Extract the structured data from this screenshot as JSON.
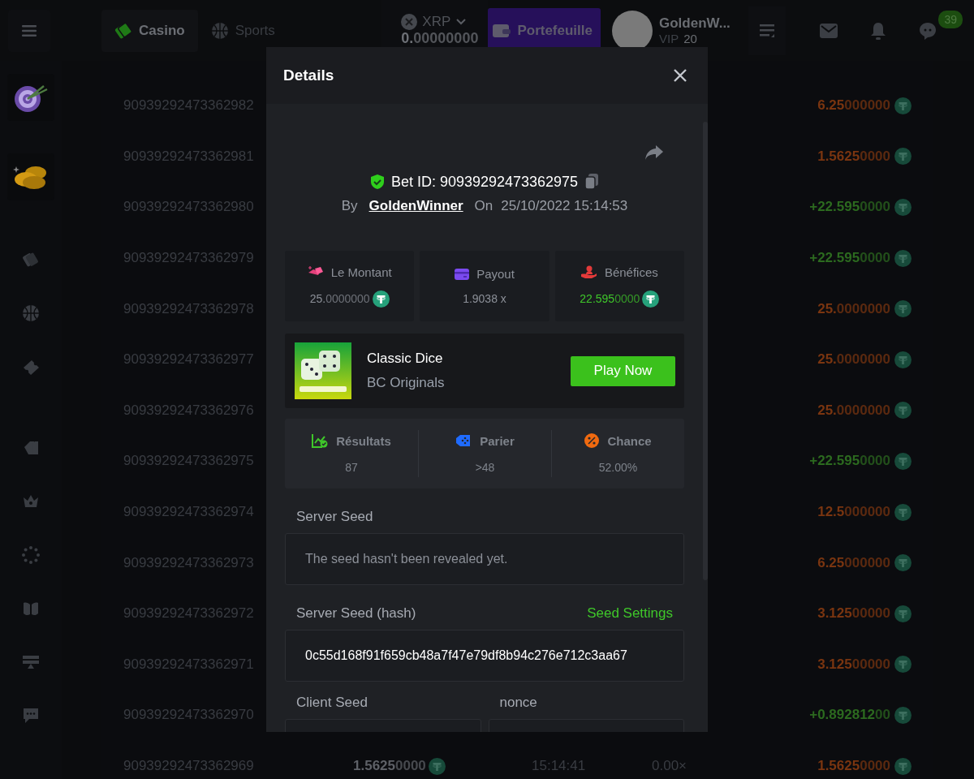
{
  "top_bar": {
    "nav_tabs": [
      {
        "label": "Casino",
        "selected": true,
        "kind": "casino"
      },
      {
        "label": "Sports",
        "selected": false,
        "kind": "sports"
      }
    ],
    "currency": {
      "code": "XRP",
      "balance": "0.00000000"
    },
    "wallet_button": "Portefeuille",
    "user": {
      "name": "GoldenW...",
      "vip_label": "VIP",
      "vip_level": "20"
    },
    "chat_badge": "39"
  },
  "bets": [
    {
      "id": "90939292473362982",
      "amount": "6.25000000",
      "color": "#7a3510"
    },
    {
      "id": "90939292473362981",
      "amount": "1.56250000",
      "color": "#7a3510"
    },
    {
      "id": "90939292473362980",
      "amount": "+22.5950000",
      "color": "#2c6a1f"
    },
    {
      "id": "90939292473362979",
      "amount": "+22.5950000",
      "color": "#2c6a1f"
    },
    {
      "id": "90939292473362978",
      "amount": "25.0000000",
      "color": "#7a3510"
    },
    {
      "id": "90939292473362977",
      "amount": "25.0000000",
      "color": "#7a3510"
    },
    {
      "id": "90939292473362976",
      "amount": "25.0000000",
      "color": "#7a3510"
    },
    {
      "id": "90939292473362975",
      "amount": "+22.5950000",
      "color": "#2c6a1f"
    },
    {
      "id": "90939292473362974",
      "amount": "12.5000000",
      "color": "#7a3510"
    },
    {
      "id": "90939292473362973",
      "amount": "6.25000000",
      "color": "#7a3510"
    },
    {
      "id": "90939292473362972",
      "amount": "3.12500000",
      "color": "#7a3510"
    },
    {
      "id": "90939292473362971",
      "amount": "3.12500000",
      "color": "#7a3510"
    },
    {
      "id": "90939292473362970",
      "amount": "+0.89281200",
      "color": "#2c6a1f"
    },
    {
      "id": "90939292473362969",
      "bet_amount": "1.56250000",
      "time": "15:14:41",
      "payout": "0.00×",
      "amount": "1.56250000",
      "color": "#7a3510"
    }
  ],
  "modal": {
    "title": "Details",
    "bet_id_label": "Bet ID:",
    "bet_id": "90939292473362975",
    "by_label": "By",
    "player": "GoldenWinner",
    "on_label": "On",
    "date": "25/10/2022 15:14:53",
    "stats": [
      {
        "kind": "amount",
        "label": "Le Montant",
        "value": "25.0000000",
        "coin": true
      },
      {
        "kind": "payout",
        "label": "Payout",
        "value": "1.9038 x",
        "coin": false
      },
      {
        "kind": "profit",
        "label": "Bénéfices",
        "value": "22.5950000",
        "coin": true
      }
    ],
    "game": {
      "name": "Classic Dice",
      "provider": "BC Originals",
      "button": "Play Now"
    },
    "details": [
      {
        "kind": "result",
        "label": "Résultats",
        "value": "87"
      },
      {
        "kind": "bet",
        "label": "Parier",
        "value": ">48"
      },
      {
        "kind": "chance",
        "label": "Chance",
        "value": "52.00%"
      }
    ],
    "server_seed": {
      "label": "Server Seed",
      "value": "The seed hasn't been revealed yet."
    },
    "server_seed_hash": {
      "label": "Server Seed (hash)",
      "link": "Seed Settings",
      "value": "0c55d168f91f659cb48a7f47e79df8b94c276e712c3aa67"
    },
    "client_seed": {
      "label": "Client Seed"
    },
    "nonce": {
      "label": "nonce"
    }
  }
}
